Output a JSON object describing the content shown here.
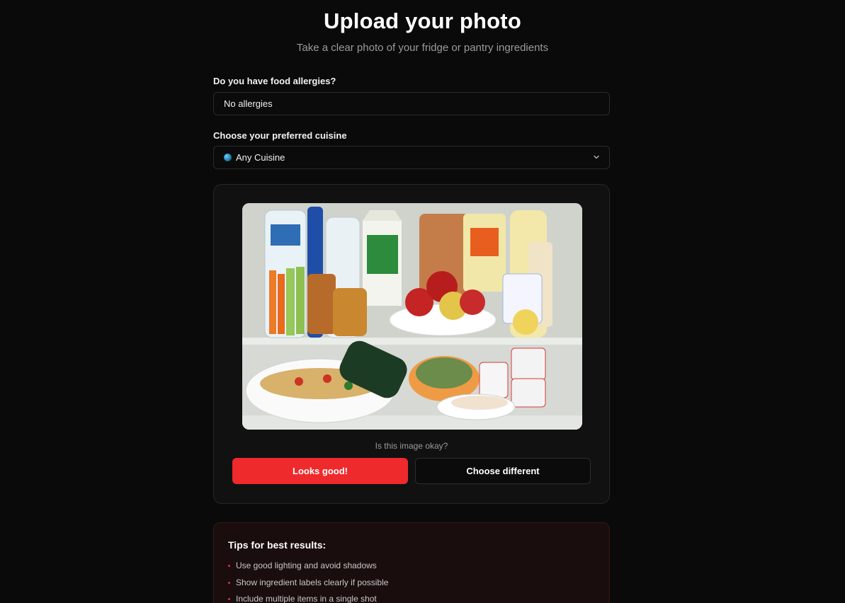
{
  "header": {
    "title": "Upload your photo",
    "subtitle": "Take a clear photo of your fridge or pantry ingredients"
  },
  "allergies": {
    "label": "Do you have food allergies?",
    "value": "No allergies"
  },
  "cuisine": {
    "label": "Choose your preferred cuisine",
    "selected": "Any Cuisine",
    "icon": "globe-icon"
  },
  "preview": {
    "question": "Is this image okay?",
    "confirm_label": "Looks good!",
    "change_label": "Choose different"
  },
  "tips": {
    "title": "Tips for best results:",
    "items": [
      "Use good lighting and avoid shadows",
      "Show ingredient labels clearly if possible",
      "Include multiple items in a single shot"
    ]
  },
  "colors": {
    "accent": "#ee2a2c",
    "background": "#0a0a0a"
  }
}
